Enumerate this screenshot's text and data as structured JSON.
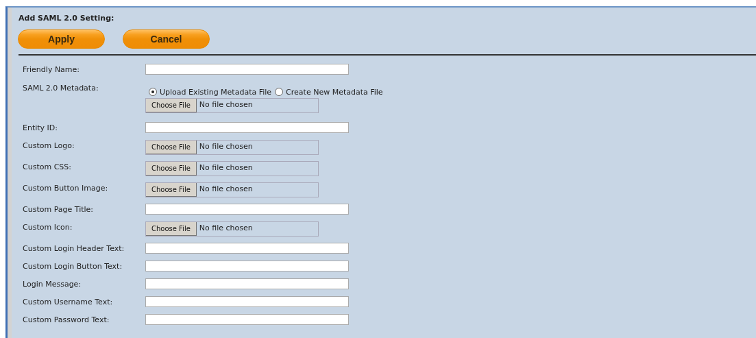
{
  "title": "Add SAML 2.0 Setting:",
  "buttons": [
    "Apply",
    "Cancel"
  ],
  "fields": [
    {
      "kind": "text",
      "label": "Friendly Name:"
    },
    {
      "kind": "metadata",
      "label": "SAML 2.0 Metadata:",
      "options": [
        {
          "label": "Upload Existing Metadata File",
          "selected": true
        },
        {
          "label": "Create New Metadata File",
          "selected": false
        }
      ],
      "button": "Choose File",
      "status": "No file chosen"
    },
    {
      "kind": "text",
      "label": "Entity ID:"
    },
    {
      "kind": "file",
      "label": "Custom Logo:",
      "button": "Choose File",
      "status": "No file chosen"
    },
    {
      "kind": "file",
      "label": "Custom CSS:",
      "button": "Choose File",
      "status": "No file chosen"
    },
    {
      "kind": "file",
      "label": "Custom Button Image:",
      "button": "Choose File",
      "status": "No file chosen"
    },
    {
      "kind": "text",
      "label": "Custom Page Title:"
    },
    {
      "kind": "file",
      "label": "Custom Icon:",
      "button": "Choose File",
      "status": "No file chosen"
    },
    {
      "kind": "text",
      "label": "Custom Login Header Text:"
    },
    {
      "kind": "text",
      "label": "Custom Login Button Text:"
    },
    {
      "kind": "text",
      "label": "Login Message:"
    },
    {
      "kind": "text",
      "label": "Custom Username Text:"
    },
    {
      "kind": "text",
      "label": "Custom Password Text:"
    }
  ]
}
